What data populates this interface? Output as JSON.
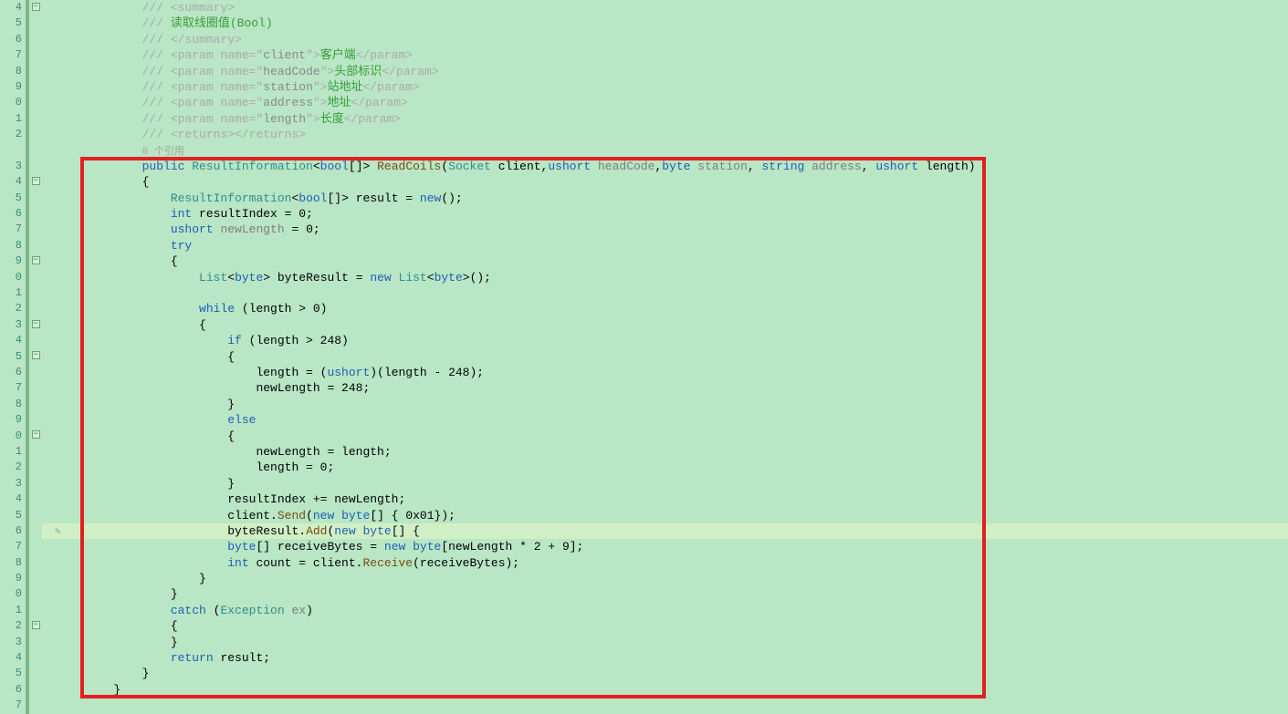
{
  "lineStart": 4,
  "lines": [
    {
      "n": "4",
      "fold": "-",
      "tokens": [
        {
          "t": "/// ",
          "c": "c-xmlcomment"
        },
        {
          "t": "<summary>",
          "c": "c-xmlcomment"
        }
      ]
    },
    {
      "n": "5",
      "fold": "",
      "tokens": [
        {
          "t": "/// ",
          "c": "c-xmlcomment"
        },
        {
          "t": "读取线圈值(Bool)",
          "c": "c-comment"
        }
      ]
    },
    {
      "n": "6",
      "fold": "",
      "tokens": [
        {
          "t": "/// ",
          "c": "c-xmlcomment"
        },
        {
          "t": "</summary>",
          "c": "c-xmlcomment"
        }
      ]
    },
    {
      "n": "7",
      "fold": "",
      "tokens": [
        {
          "t": "/// ",
          "c": "c-xmlcomment"
        },
        {
          "t": "<param name=\"",
          "c": "c-xmlcomment"
        },
        {
          "t": "client",
          "c": "c-xmlname"
        },
        {
          "t": "\">",
          "c": "c-xmlcomment"
        },
        {
          "t": "客户端",
          "c": "c-comment"
        },
        {
          "t": "</param>",
          "c": "c-xmlcomment"
        }
      ]
    },
    {
      "n": "8",
      "fold": "",
      "tokens": [
        {
          "t": "/// ",
          "c": "c-xmlcomment"
        },
        {
          "t": "<param name=\"",
          "c": "c-xmlcomment"
        },
        {
          "t": "headCode",
          "c": "c-xmlname"
        },
        {
          "t": "\">",
          "c": "c-xmlcomment"
        },
        {
          "t": "头部标识",
          "c": "c-comment"
        },
        {
          "t": "</param>",
          "c": "c-xmlcomment"
        }
      ]
    },
    {
      "n": "9",
      "fold": "",
      "tokens": [
        {
          "t": "/// ",
          "c": "c-xmlcomment"
        },
        {
          "t": "<param name=\"",
          "c": "c-xmlcomment"
        },
        {
          "t": "station",
          "c": "c-xmlname"
        },
        {
          "t": "\">",
          "c": "c-xmlcomment"
        },
        {
          "t": "站地址",
          "c": "c-comment"
        },
        {
          "t": "</param>",
          "c": "c-xmlcomment"
        }
      ]
    },
    {
      "n": "0",
      "fold": "",
      "tokens": [
        {
          "t": "/// ",
          "c": "c-xmlcomment"
        },
        {
          "t": "<param name=\"",
          "c": "c-xmlcomment"
        },
        {
          "t": "address",
          "c": "c-xmlname"
        },
        {
          "t": "\">",
          "c": "c-xmlcomment"
        },
        {
          "t": "地址",
          "c": "c-comment"
        },
        {
          "t": "</param>",
          "c": "c-xmlcomment"
        }
      ]
    },
    {
      "n": "1",
      "fold": "",
      "tokens": [
        {
          "t": "/// ",
          "c": "c-xmlcomment"
        },
        {
          "t": "<param name=\"",
          "c": "c-xmlcomment"
        },
        {
          "t": "length",
          "c": "c-xmlname"
        },
        {
          "t": "\">",
          "c": "c-xmlcomment"
        },
        {
          "t": "长度",
          "c": "c-comment"
        },
        {
          "t": "</param>",
          "c": "c-xmlcomment"
        }
      ]
    },
    {
      "n": "2",
      "fold": "",
      "tokens": [
        {
          "t": "/// ",
          "c": "c-xmlcomment"
        },
        {
          "t": "<returns></returns>",
          "c": "c-xmlcomment"
        }
      ]
    },
    {
      "n": "",
      "fold": "",
      "tokens": [
        {
          "t": "0 个引用",
          "c": "c-ref"
        }
      ],
      "ref": true
    },
    {
      "n": "3",
      "fold": "",
      "tokens": [
        {
          "t": "public ",
          "c": "c-keyword"
        },
        {
          "t": "ResultInformation",
          "c": "c-type"
        },
        {
          "t": "<",
          "c": ""
        },
        {
          "t": "bool",
          "c": "c-keyword"
        },
        {
          "t": "[]> ",
          "c": ""
        },
        {
          "t": "ReadCoils",
          "c": "c-method"
        },
        {
          "t": "(",
          "c": ""
        },
        {
          "t": "Socket",
          "c": "c-type"
        },
        {
          "t": " client,",
          "c": ""
        },
        {
          "t": "ushort",
          "c": "c-keyword"
        },
        {
          "t": " ",
          "c": ""
        },
        {
          "t": "headCode",
          "c": "c-param"
        },
        {
          "t": ",",
          "c": ""
        },
        {
          "t": "byte",
          "c": "c-keyword"
        },
        {
          "t": " ",
          "c": ""
        },
        {
          "t": "station",
          "c": "c-param"
        },
        {
          "t": ", ",
          "c": ""
        },
        {
          "t": "string",
          "c": "c-keyword"
        },
        {
          "t": " ",
          "c": ""
        },
        {
          "t": "address",
          "c": "c-param"
        },
        {
          "t": ", ",
          "c": ""
        },
        {
          "t": "ushort",
          "c": "c-keyword"
        },
        {
          "t": " length)",
          "c": ""
        }
      ]
    },
    {
      "n": "4",
      "fold": "-",
      "tokens": [
        {
          "t": "{",
          "c": ""
        }
      ]
    },
    {
      "n": "5",
      "fold": "",
      "indent": 1,
      "tokens": [
        {
          "t": "ResultInformation",
          "c": "c-type"
        },
        {
          "t": "<",
          "c": ""
        },
        {
          "t": "bool",
          "c": "c-keyword"
        },
        {
          "t": "[]> result = ",
          "c": ""
        },
        {
          "t": "new",
          "c": "c-keyword"
        },
        {
          "t": "();",
          "c": ""
        }
      ]
    },
    {
      "n": "6",
      "fold": "",
      "indent": 1,
      "tokens": [
        {
          "t": "int",
          "c": "c-keyword"
        },
        {
          "t": " resultIndex = 0;",
          "c": ""
        }
      ]
    },
    {
      "n": "7",
      "fold": "",
      "indent": 1,
      "tokens": [
        {
          "t": "ushort",
          "c": "c-keyword"
        },
        {
          "t": " ",
          "c": ""
        },
        {
          "t": "newLength",
          "c": "c-param"
        },
        {
          "t": " = 0;",
          "c": ""
        }
      ]
    },
    {
      "n": "8",
      "fold": "",
      "indent": 1,
      "tokens": [
        {
          "t": "try",
          "c": "c-keyword"
        }
      ]
    },
    {
      "n": "9",
      "fold": "-",
      "indent": 1,
      "tokens": [
        {
          "t": "{",
          "c": ""
        }
      ]
    },
    {
      "n": "0",
      "fold": "",
      "indent": 2,
      "tokens": [
        {
          "t": "List",
          "c": "c-type"
        },
        {
          "t": "<",
          "c": ""
        },
        {
          "t": "byte",
          "c": "c-keyword"
        },
        {
          "t": "> byteResult = ",
          "c": ""
        },
        {
          "t": "new",
          "c": "c-keyword"
        },
        {
          "t": " ",
          "c": ""
        },
        {
          "t": "List",
          "c": "c-type"
        },
        {
          "t": "<",
          "c": ""
        },
        {
          "t": "byte",
          "c": "c-keyword"
        },
        {
          "t": ">();",
          "c": ""
        }
      ]
    },
    {
      "n": "1",
      "fold": "",
      "indent": 2,
      "tokens": []
    },
    {
      "n": "2",
      "fold": "",
      "indent": 2,
      "tokens": [
        {
          "t": "while",
          "c": "c-keyword"
        },
        {
          "t": " (length > 0)",
          "c": ""
        }
      ]
    },
    {
      "n": "3",
      "fold": "-",
      "indent": 2,
      "tokens": [
        {
          "t": "{",
          "c": ""
        }
      ]
    },
    {
      "n": "4",
      "fold": "",
      "indent": 3,
      "tokens": [
        {
          "t": "if",
          "c": "c-keyword"
        },
        {
          "t": " (length > 248)",
          "c": ""
        }
      ]
    },
    {
      "n": "5",
      "fold": "-",
      "indent": 3,
      "tokens": [
        {
          "t": "{",
          "c": ""
        }
      ]
    },
    {
      "n": "6",
      "fold": "",
      "indent": 4,
      "tokens": [
        {
          "t": "length = (",
          "c": ""
        },
        {
          "t": "ushort",
          "c": "c-keyword"
        },
        {
          "t": ")(length - 248);",
          "c": ""
        }
      ]
    },
    {
      "n": "7",
      "fold": "",
      "indent": 4,
      "tokens": [
        {
          "t": "newLength = 248;",
          "c": ""
        }
      ]
    },
    {
      "n": "8",
      "fold": "",
      "indent": 3,
      "tokens": [
        {
          "t": "}",
          "c": ""
        }
      ]
    },
    {
      "n": "9",
      "fold": "",
      "indent": 3,
      "tokens": [
        {
          "t": "else",
          "c": "c-keyword"
        }
      ]
    },
    {
      "n": "0",
      "fold": "-",
      "indent": 3,
      "tokens": [
        {
          "t": "{",
          "c": ""
        }
      ]
    },
    {
      "n": "1",
      "fold": "",
      "indent": 4,
      "tokens": [
        {
          "t": "newLength = length;",
          "c": ""
        }
      ]
    },
    {
      "n": "2",
      "fold": "",
      "indent": 4,
      "tokens": [
        {
          "t": "length = 0;",
          "c": ""
        }
      ]
    },
    {
      "n": "3",
      "fold": "",
      "indent": 3,
      "tokens": [
        {
          "t": "}",
          "c": ""
        }
      ]
    },
    {
      "n": "4",
      "fold": "",
      "indent": 3,
      "tokens": [
        {
          "t": "resultIndex += newLength;",
          "c": ""
        }
      ]
    },
    {
      "n": "5",
      "fold": "",
      "indent": 3,
      "tokens": [
        {
          "t": "client.",
          "c": ""
        },
        {
          "t": "Send",
          "c": "c-method"
        },
        {
          "t": "(",
          "c": ""
        },
        {
          "t": "new",
          "c": "c-keyword"
        },
        {
          "t": " ",
          "c": ""
        },
        {
          "t": "byte",
          "c": "c-keyword"
        },
        {
          "t": "[] { 0x01});",
          "c": ""
        }
      ]
    },
    {
      "n": "6",
      "fold": "",
      "indent": 3,
      "tokens": [
        {
          "t": "byteResult.",
          "c": ""
        },
        {
          "t": "Add",
          "c": "c-method"
        },
        {
          "t": "(",
          "c": ""
        },
        {
          "t": "new",
          "c": "c-keyword"
        },
        {
          "t": " ",
          "c": ""
        },
        {
          "t": "byte",
          "c": "c-keyword"
        },
        {
          "t": "[] {",
          "c": ""
        }
      ],
      "cursor": true
    },
    {
      "n": "7",
      "fold": "",
      "indent": 3,
      "tokens": [
        {
          "t": "byte",
          "c": "c-keyword"
        },
        {
          "t": "[] receiveBytes = ",
          "c": ""
        },
        {
          "t": "new",
          "c": "c-keyword"
        },
        {
          "t": " ",
          "c": ""
        },
        {
          "t": "byte",
          "c": "c-keyword"
        },
        {
          "t": "[newLength * 2 + 9];",
          "c": ""
        }
      ]
    },
    {
      "n": "8",
      "fold": "",
      "indent": 3,
      "tokens": [
        {
          "t": "int",
          "c": "c-keyword"
        },
        {
          "t": " count = client.",
          "c": ""
        },
        {
          "t": "Receive",
          "c": "c-method"
        },
        {
          "t": "(receiveBytes);",
          "c": ""
        }
      ]
    },
    {
      "n": "9",
      "fold": "",
      "indent": 2,
      "tokens": [
        {
          "t": "}",
          "c": ""
        }
      ]
    },
    {
      "n": "0",
      "fold": "",
      "indent": 1,
      "tokens": [
        {
          "t": "}",
          "c": ""
        }
      ]
    },
    {
      "n": "1",
      "fold": "",
      "indent": 1,
      "tokens": [
        {
          "t": "catch",
          "c": "c-keyword"
        },
        {
          "t": " (",
          "c": ""
        },
        {
          "t": "Exception",
          "c": "c-type"
        },
        {
          "t": " ",
          "c": ""
        },
        {
          "t": "ex",
          "c": "c-param"
        },
        {
          "t": ")",
          "c": ""
        }
      ]
    },
    {
      "n": "2",
      "fold": "-",
      "indent": 1,
      "tokens": [
        {
          "t": "{",
          "c": ""
        }
      ]
    },
    {
      "n": "3",
      "fold": "",
      "indent": 1,
      "tokens": [
        {
          "t": "}",
          "c": ""
        }
      ]
    },
    {
      "n": "4",
      "fold": "",
      "indent": 1,
      "tokens": [
        {
          "t": "return",
          "c": "c-keyword"
        },
        {
          "t": " result;",
          "c": ""
        }
      ]
    },
    {
      "n": "5",
      "fold": "",
      "tokens": [
        {
          "t": "}",
          "c": ""
        }
      ]
    },
    {
      "n": "6",
      "fold": "",
      "tokens": [
        {
          "t": "}",
          "c": ""
        }
      ],
      "outdent": true
    },
    {
      "n": "7",
      "fold": "",
      "tokens": []
    }
  ],
  "baseIndent": "            ",
  "cursorMarker": "✎"
}
